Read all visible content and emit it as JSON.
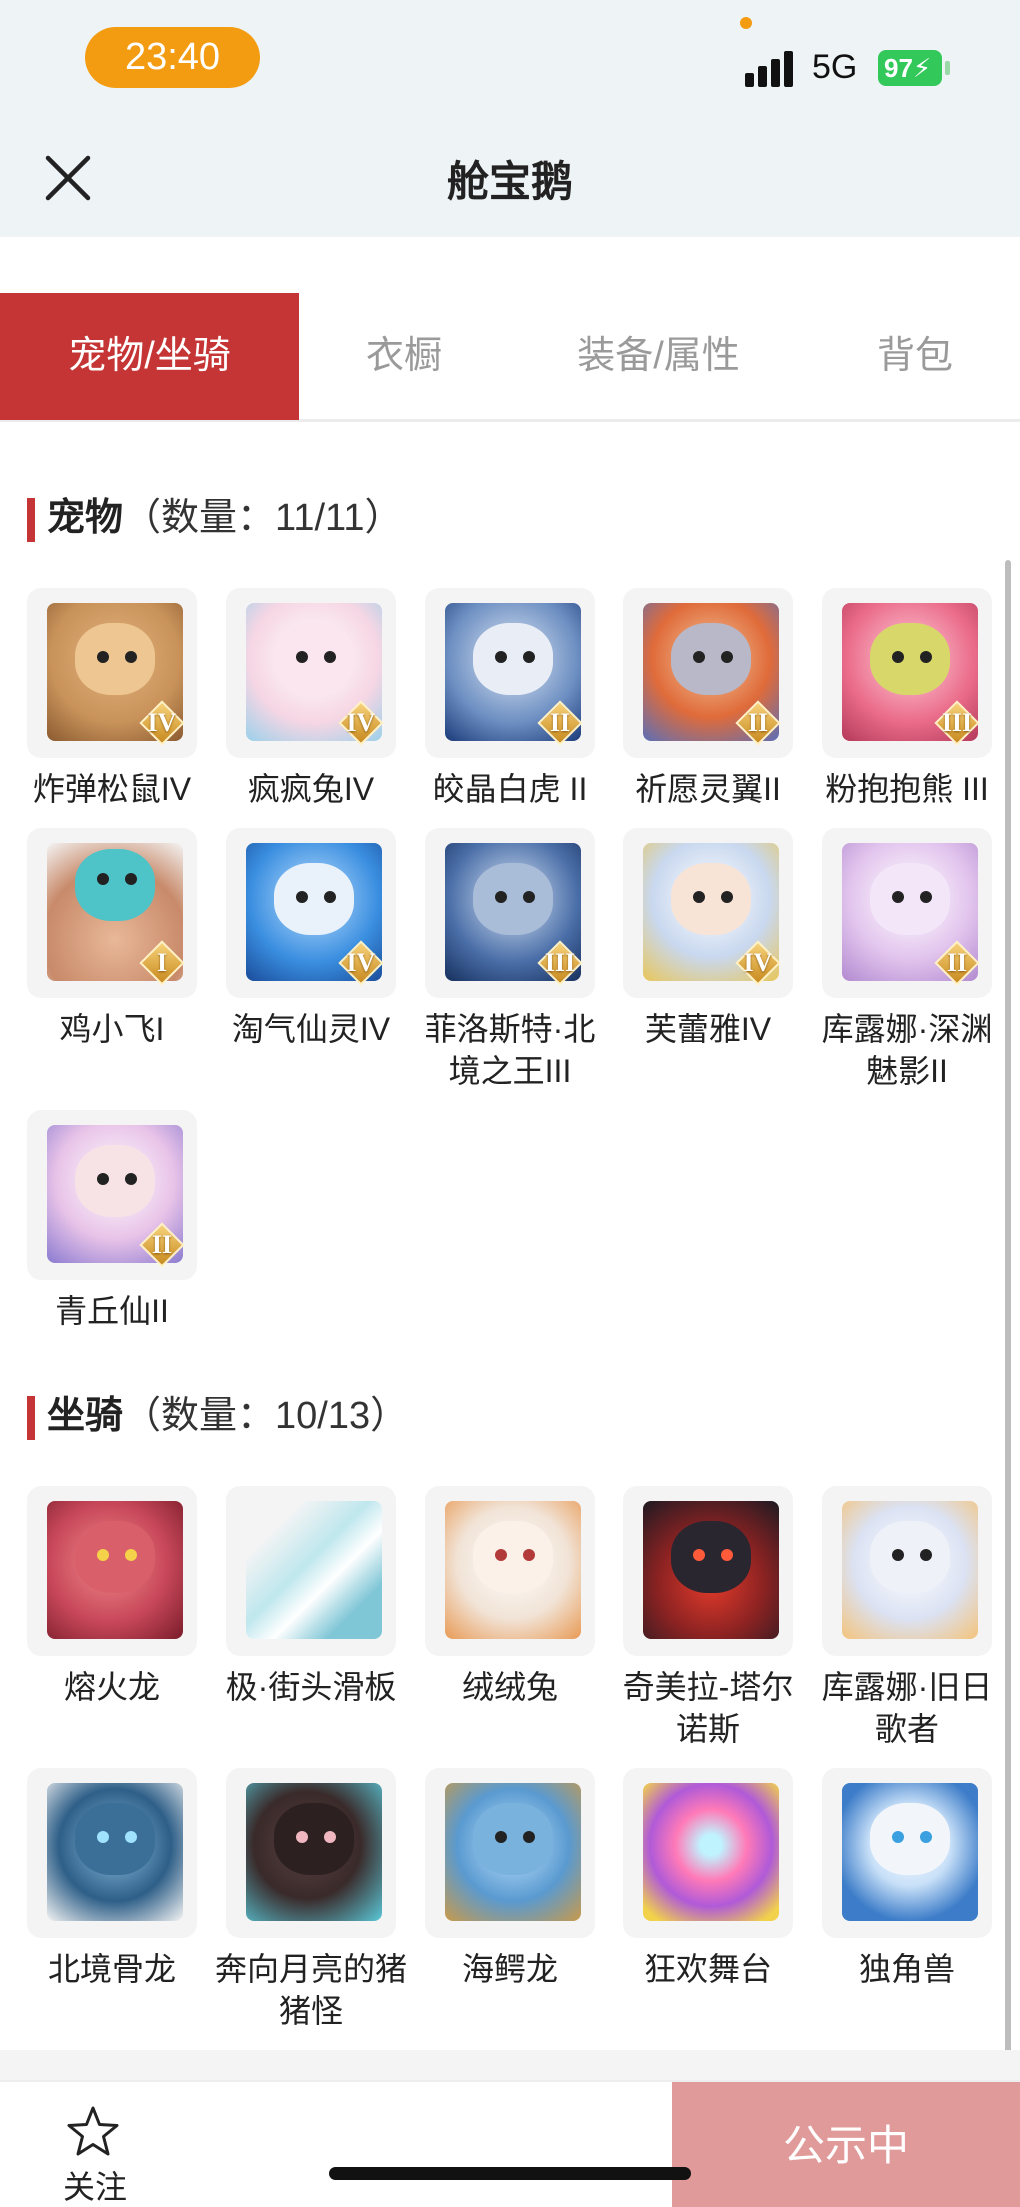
{
  "status_bar": {
    "time": "23:40",
    "network": "5G",
    "battery": "97"
  },
  "header": {
    "title": "舱宝鹅",
    "close_icon": "close-icon"
  },
  "tabs": [
    {
      "label": "宠物/坐骑",
      "active": true
    },
    {
      "label": "衣橱",
      "active": false
    },
    {
      "label": "装备/属性",
      "active": false
    },
    {
      "label": "背包",
      "active": false
    }
  ],
  "pets": {
    "name": "宠物",
    "count": "（数量：11/11）",
    "items": [
      {
        "name": "炸弹松鼠IV",
        "tier": "IV",
        "color": "#c8925a"
      },
      {
        "name": "疯疯兔IV",
        "tier": "IV",
        "color": "#f6d6e4"
      },
      {
        "name": "皎晶白虎 II",
        "tier": "II",
        "color": "#6d8fc2"
      },
      {
        "name": "祈愿灵翼II",
        "tier": "II",
        "color": "#e06b3a"
      },
      {
        "name": "粉抱抱熊 III",
        "tier": "III",
        "color": "#ea6b8a"
      },
      {
        "name": "鸡小飞I",
        "tier": "I",
        "color": "#4ec3c8"
      },
      {
        "name": "淘气仙灵IV",
        "tier": "IV",
        "color": "#3a8ee0"
      },
      {
        "name": "菲洛斯特·北境之王III",
        "tier": "III",
        "color": "#4a6ea8"
      },
      {
        "name": "芙蕾雅IV",
        "tier": "IV",
        "color": "#c9d8ef"
      },
      {
        "name": "库露娜·深渊魅影II",
        "tier": "II",
        "color": "#e3c6ee"
      },
      {
        "name": "青丘仙II",
        "tier": "II",
        "color": "#e8c3e8"
      }
    ]
  },
  "mounts": {
    "name": "坐骑",
    "count": "（数量：10/13）",
    "items": [
      {
        "name": "熔火龙",
        "color": "#c8485a"
      },
      {
        "name": "极·街头滑板",
        "color": "#bfe7ee"
      },
      {
        "name": "绒绒兔",
        "color": "#f1e3d6"
      },
      {
        "name": "奇美拉-塔尔诺斯",
        "color": "#8a2222"
      },
      {
        "name": "库露娜·旧日歌者",
        "color": "#dbe2f3"
      },
      {
        "name": "北境骨龙",
        "color": "#2e5f88"
      },
      {
        "name": "奔向月亮的猪猪怪",
        "color": "#3a2a2a"
      },
      {
        "name": "海鳄龙",
        "color": "#5a9ad0"
      },
      {
        "name": "狂欢舞台",
        "color": "#b05ad8"
      },
      {
        "name": "独角兽",
        "color": "#3c7cc8"
      }
    ]
  },
  "footer": {
    "follow_label": "关注",
    "status_label": "公示中"
  }
}
